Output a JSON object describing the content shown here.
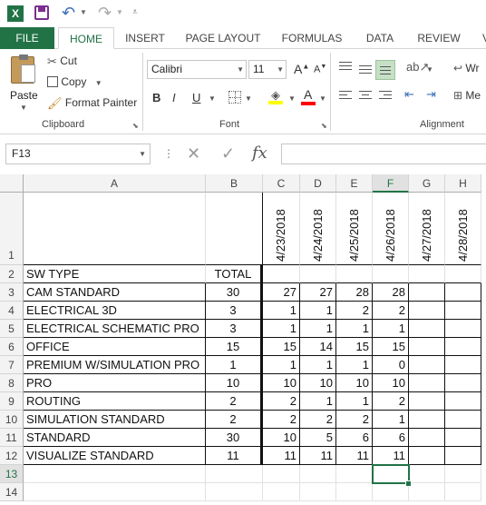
{
  "qat": {
    "app_logo": "X"
  },
  "tabs": [
    "FILE",
    "HOME",
    "INSERT",
    "PAGE LAYOUT",
    "FORMULAS",
    "DATA",
    "REVIEW",
    "V"
  ],
  "clipboard": {
    "paste": "Paste",
    "cut": "Cut",
    "copy": "Copy",
    "format_painter": "Format Painter",
    "label": "Clipboard"
  },
  "font": {
    "name": "Calibri",
    "size": "11",
    "bold": "B",
    "italic": "I",
    "underline": "U",
    "label": "Font",
    "font_color_letter": "A",
    "grow_letter": "A",
    "shrink_letter": "A"
  },
  "alignment": {
    "label": "Alignment",
    "wrap": "Wr",
    "merge": "Me"
  },
  "formula_bar": {
    "name_box": "F13",
    "fx": "fx",
    "formula": ""
  },
  "colors": {
    "accent": "#217346",
    "highlight": "#ffff00",
    "font_red": "#ff0000"
  },
  "columns": [
    "A",
    "B",
    "C",
    "D",
    "E",
    "F",
    "G",
    "H"
  ],
  "selected_cell": "F13",
  "dates": [
    "4/23/2018",
    "4/24/2018",
    "4/25/2018",
    "4/26/2018",
    "4/27/2018",
    "4/28/2018"
  ],
  "header_row": {
    "type": "SW TYPE",
    "total": "TOTAL"
  },
  "rows": [
    {
      "name": "CAM STANDARD",
      "total": "30",
      "vals": [
        "27",
        "27",
        "28",
        "28"
      ]
    },
    {
      "name": "ELECTRICAL 3D",
      "total": "3",
      "vals": [
        "1",
        "1",
        "2",
        "2"
      ]
    },
    {
      "name": "ELECTRICAL SCHEMATIC PRO",
      "total": "3",
      "vals": [
        "1",
        "1",
        "1",
        "1"
      ]
    },
    {
      "name": "OFFICE",
      "total": "15",
      "vals": [
        "15",
        "14",
        "15",
        "15"
      ]
    },
    {
      "name": "PREMIUM W/SIMULATION PRO",
      "total": "1",
      "vals": [
        "1",
        "1",
        "1",
        "0"
      ]
    },
    {
      "name": "PRO",
      "total": "10",
      "vals": [
        "10",
        "10",
        "10",
        "10"
      ]
    },
    {
      "name": "ROUTING",
      "total": "2",
      "vals": [
        "2",
        "1",
        "1",
        "2"
      ]
    },
    {
      "name": "SIMULATION STANDARD",
      "total": "2",
      "vals": [
        "2",
        "2",
        "2",
        "1"
      ]
    },
    {
      "name": "STANDARD",
      "total": "30",
      "vals": [
        "10",
        "5",
        "6",
        "6"
      ]
    },
    {
      "name": "VISUALIZE STANDARD",
      "total": "11",
      "vals": [
        "11",
        "11",
        "11",
        "11"
      ]
    }
  ],
  "row_numbers": [
    "1",
    "2",
    "3",
    "4",
    "5",
    "6",
    "7",
    "8",
    "9",
    "10",
    "11",
    "12",
    "13",
    "14"
  ]
}
